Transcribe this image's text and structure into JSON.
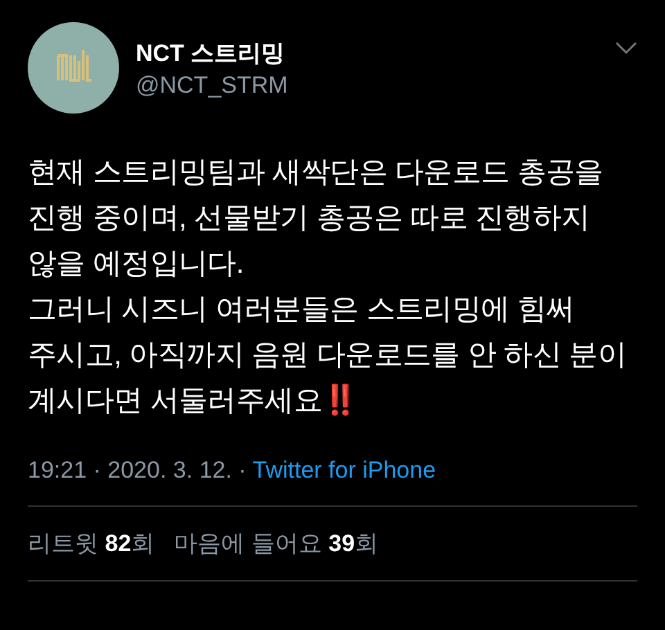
{
  "author": {
    "name": "NCT 스트리밍",
    "handle": "@NCT_STRM"
  },
  "paragraphs": [
    "현재 스트리밍팀과 새싹단은 다운로드 총공을 진행 중이며, 선물받기 총공은 따로 진행하지 않을 예정입니다.",
    "그러니 시즈니 여러분들은 스트리밍에 힘써 주시고, 아직까지 음원 다운로드를 안 하신 분이 계시다면 서둘러주세요‼️"
  ],
  "meta": {
    "time": "19:21 · 2020. 3. 12. · ",
    "source": "Twitter for iPhone"
  },
  "stats": [
    "리트윗 **82**회",
    "마음에 들어요 **39**회"
  ]
}
